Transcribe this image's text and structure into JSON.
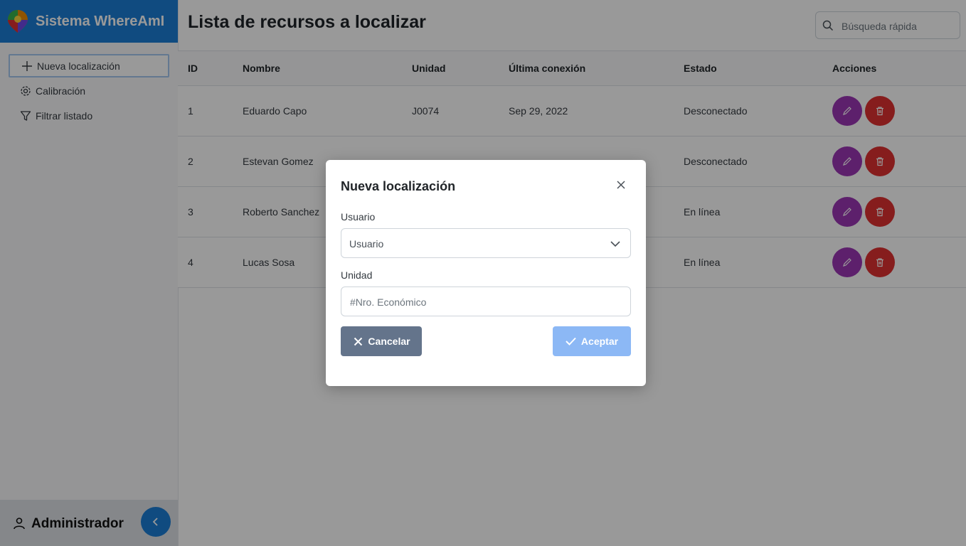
{
  "app": {
    "title": "Sistema WhereAmI"
  },
  "sidebar": {
    "items": [
      {
        "label": "Nueva localización",
        "icon": "plus-icon"
      },
      {
        "label": "Calibración",
        "icon": "gear-icon"
      },
      {
        "label": "Filtrar listado",
        "icon": "filter-icon"
      }
    ],
    "user": "Administrador"
  },
  "main": {
    "title": "Lista de recursos a localizar",
    "search": {
      "placeholder": "Búsqueda rápida",
      "value": ""
    },
    "table": {
      "headers": [
        "ID",
        "Nombre",
        "Unidad",
        "Última conexión",
        "Estado",
        "Acciones"
      ],
      "rows": [
        {
          "id": "1",
          "nombre": "Eduardo Capo",
          "unidad": "J0074",
          "conexion": "Sep 29, 2022",
          "estado": "Desconectado"
        },
        {
          "id": "2",
          "nombre": "Estevan Gomez",
          "unidad": "",
          "conexion": "",
          "estado": "Desconectado"
        },
        {
          "id": "3",
          "nombre": "Roberto Sanchez",
          "unidad": "",
          "conexion": "",
          "estado": "En línea"
        },
        {
          "id": "4",
          "nombre": "Lucas Sosa",
          "unidad": "",
          "conexion": "",
          "estado": "En línea"
        }
      ]
    }
  },
  "modal": {
    "title": "Nueva localización",
    "usuario_label": "Usuario",
    "usuario_value": "Usuario",
    "unidad_label": "Unidad",
    "unidad_placeholder": "#Nro. Económico",
    "unidad_value": "",
    "cancel_label": "Cancelar",
    "accept_label": "Aceptar"
  },
  "colors": {
    "brand": "#1c7ed6",
    "edit": "#9c36b5",
    "delete": "#e03131",
    "cancel": "#64748b",
    "accept": "#8cb8f5"
  }
}
